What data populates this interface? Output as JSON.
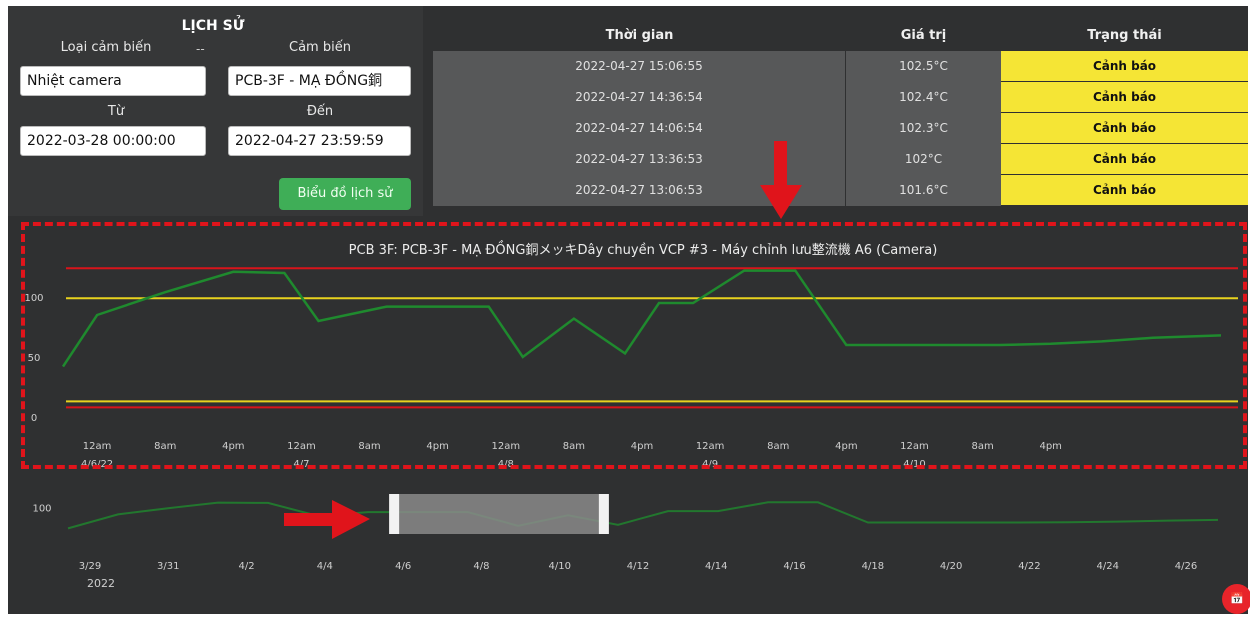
{
  "form": {
    "title": "LỊCH SỬ",
    "separator": "--",
    "sensor_type_label": "Loại cảm biến",
    "sensor_label": "Cảm biến",
    "sensor_type_value": "Nhiệt camera",
    "sensor_value": "PCB-3F - MẠ ĐỒNG銅",
    "from_label": "Từ",
    "to_label": "Đến",
    "from_value": "2022-03-28 00:00:00",
    "to_value": "2022-04-27 23:59:59",
    "history_button": "Biểu đồ lịch sử"
  },
  "table": {
    "headers": {
      "time": "Thời gian",
      "value": "Giá trị",
      "status": "Trạng thái"
    },
    "rows": [
      {
        "time": "2022-04-27 15:06:55",
        "value": "102.5°C",
        "status": "Cảnh báo"
      },
      {
        "time": "2022-04-27 14:36:54",
        "value": "102.4°C",
        "status": "Cảnh báo"
      },
      {
        "time": "2022-04-27 14:06:54",
        "value": "102.3°C",
        "status": "Cảnh báo"
      },
      {
        "time": "2022-04-27 13:36:53",
        "value": "102°C",
        "status": "Cảnh báo"
      },
      {
        "time": "2022-04-27 13:06:53",
        "value": "101.6°C",
        "status": "Cảnh báo"
      }
    ]
  },
  "colors": {
    "status_warning": "#f5e535",
    "series": "#1f8a2e",
    "limit_red": "#d9141b",
    "limit_yellow": "#e8d21e",
    "annotation": "#e0141b"
  },
  "fab": {
    "icon": "calendar-icon",
    "label": "📅"
  },
  "chart_data": [
    {
      "type": "line",
      "title": "PCB 3F: PCB-3F - MẠ ĐỒNG銅メッキDây chuyền VCP #3 - Máy chỉnh lưu整流機 A6 (Camera)",
      "xlabel": "",
      "ylabel": "",
      "ylim": [
        0,
        130
      ],
      "y_ticks": [
        "0",
        "50",
        "100"
      ],
      "x_tick_labels": [
        [
          "12am",
          "4/6/22"
        ],
        [
          "8am",
          ""
        ],
        [
          "4pm",
          ""
        ],
        [
          "12am",
          "4/7"
        ],
        [
          "8am",
          ""
        ],
        [
          "4pm",
          ""
        ],
        [
          "12am",
          "4/8"
        ],
        [
          "8am",
          ""
        ],
        [
          "4pm",
          ""
        ],
        [
          "12am",
          "4/9"
        ],
        [
          "8am",
          ""
        ],
        [
          "4pm",
          ""
        ],
        [
          "12am",
          "4/10"
        ],
        [
          "8am",
          ""
        ],
        [
          "4pm",
          ""
        ]
      ],
      "x_hours": [
        -4,
        0,
        8,
        16,
        22,
        26,
        34,
        40,
        46,
        50,
        56,
        62,
        66,
        70,
        76,
        82,
        88,
        94,
        100,
        106,
        112,
        118,
        124,
        132
      ],
      "y": [
        42,
        85,
        104,
        121,
        120,
        80,
        92,
        92,
        92,
        50,
        82,
        53,
        95,
        95,
        122,
        122,
        60,
        60,
        60,
        60,
        61,
        63,
        66,
        68
      ],
      "thresholds": {
        "red_high": 124,
        "yellow_high": 99,
        "yellow_low": 13,
        "red_low": 8
      },
      "grid": false
    },
    {
      "type": "line",
      "name": "range-navigator",
      "ylim": [
        0,
        130
      ],
      "y_ticks": [
        "100"
      ],
      "x_ticks": [
        "3/29",
        "3/31",
        "4/2",
        "4/4",
        "4/6",
        "4/8",
        "4/10",
        "4/12",
        "4/14",
        "4/16",
        "4/18",
        "4/20",
        "4/22",
        "4/24",
        "4/26"
      ],
      "x_year_label": "2022",
      "selection": [
        "4/6",
        "4/11"
      ]
    }
  ],
  "icons": {
    "down_arrow": "arrow-down-icon",
    "right_arrow": "arrow-right-icon"
  }
}
